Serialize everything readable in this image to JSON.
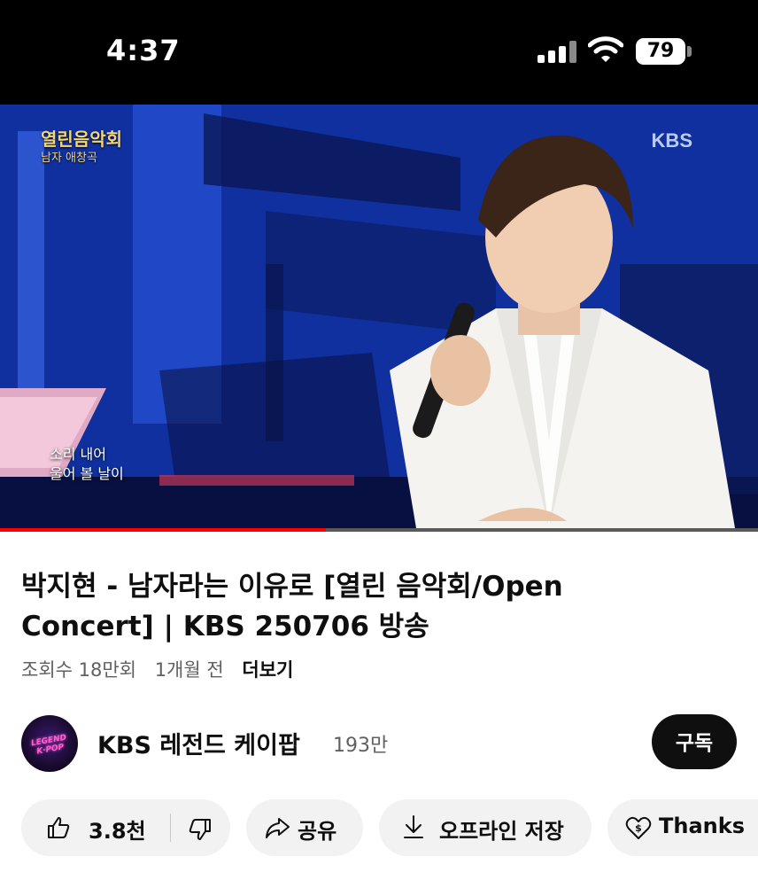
{
  "status_bar": {
    "time": "4:37",
    "battery_level": "79",
    "signal_bars": 3
  },
  "video": {
    "show_logo_main": "열린음악회",
    "show_logo_sub": "남자 애창곡",
    "broadcaster_mark": "KBS",
    "subtitle_line1": "소리 내어",
    "subtitle_line2": "울어 볼 날이",
    "progress_fraction": 0.43
  },
  "title": {
    "line1": "박지현 - 남자라는 이유로 [열린 음악회/Open",
    "line2": "Concert] | KBS 250706 방송"
  },
  "meta": {
    "views": "조회수 18만회",
    "age": "1개월 전",
    "more": "더보기"
  },
  "channel": {
    "avatar_text_line1": "LEGEND",
    "avatar_text_line2": "K·POP",
    "name": "KBS 레전드 케이팝",
    "subscribers": "193만",
    "subscribe_label": "구독"
  },
  "actions": {
    "like_count": "3.8천",
    "share_label": "공유",
    "download_label": "오프라인 저장",
    "thanks_label": "Thanks"
  },
  "colors": {
    "progress": "#ff0000",
    "pill_bg": "#f2f2f2",
    "subscribe_bg": "#0f0f0f"
  }
}
